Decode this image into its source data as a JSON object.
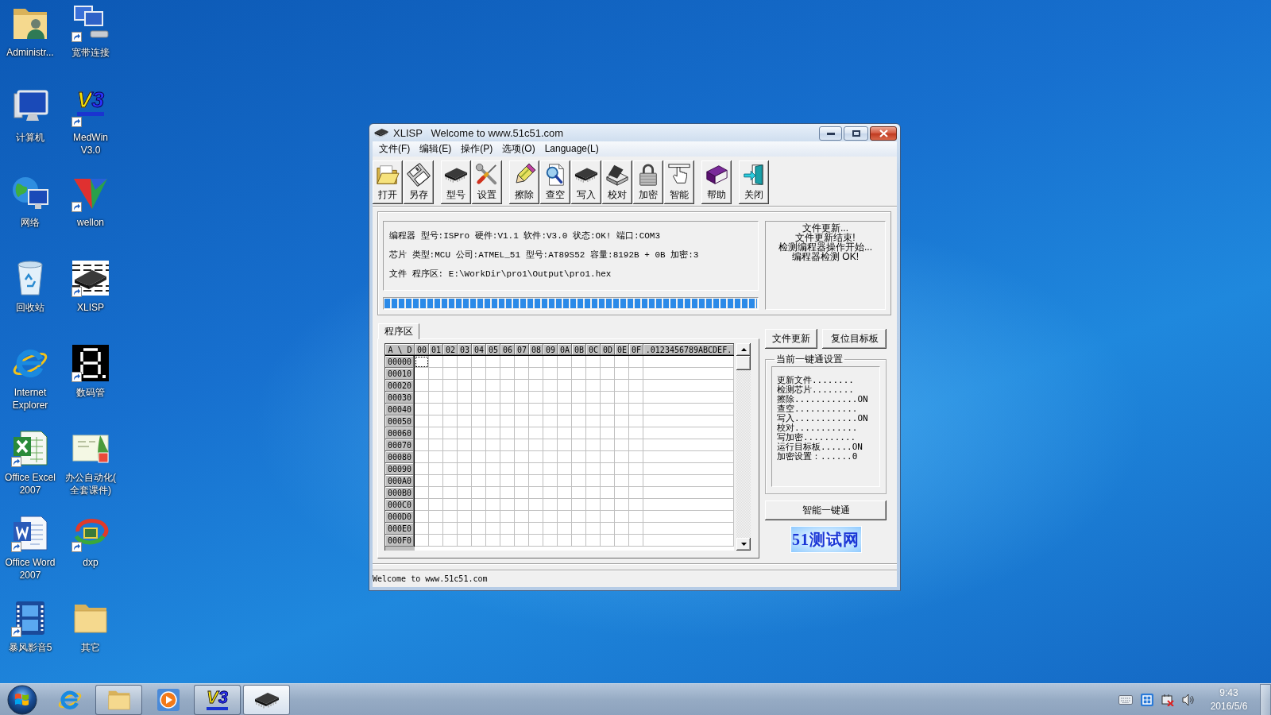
{
  "desktop": {
    "icons": [
      {
        "kind": "user-folder",
        "label": "Administr...",
        "shortcut": false
      },
      {
        "kind": "computer",
        "label": "计算机",
        "shortcut": false
      },
      {
        "kind": "network",
        "label": "网络",
        "shortcut": false
      },
      {
        "kind": "recycle-bin",
        "label": "回收站",
        "shortcut": false
      },
      {
        "kind": "ie",
        "label": "Internet\nExplorer",
        "shortcut": false
      },
      {
        "kind": "excel",
        "label": "Office Excel\n2007",
        "shortcut": true
      },
      {
        "kind": "word",
        "label": "Office Word\n2007",
        "shortcut": true
      },
      {
        "kind": "film",
        "label": "暴风影音5",
        "shortcut": true
      },
      {
        "kind": "network-connection",
        "label": "宽带连接",
        "shortcut": true
      },
      {
        "kind": "logo",
        "logo": "V3",
        "label": "MedWin\nV3.0",
        "shortcut": true
      },
      {
        "kind": "wellon",
        "label": "wellon",
        "shortcut": true
      },
      {
        "kind": "chip",
        "label": "XLISP",
        "shortcut": true
      },
      {
        "kind": "seven-segment",
        "label": "数码管",
        "shortcut": true
      },
      {
        "kind": "thumbnail",
        "label": "办公自动化(\n全套课件)",
        "shortcut": false
      },
      {
        "kind": "dxp",
        "label": "dxp",
        "shortcut": true
      },
      {
        "kind": "folder",
        "label": "其它",
        "shortcut": false
      }
    ]
  },
  "window": {
    "title": "XLISP   Welcome to www.51c51.com",
    "menu": [
      "文件(F)",
      "编辑(E)",
      "操作(P)",
      "选项(O)",
      "Language(L)"
    ],
    "toolbar": [
      {
        "buttons": [
          {
            "kind": "open",
            "label": "打开"
          },
          {
            "kind": "save",
            "label": "另存"
          }
        ]
      },
      {
        "buttons": [
          {
            "kind": "chip",
            "label": "型号"
          },
          {
            "kind": "tools",
            "label": "设置"
          }
        ]
      },
      {
        "buttons": [
          {
            "kind": "eraser",
            "label": "擦除"
          },
          {
            "kind": "search",
            "label": "查空"
          },
          {
            "kind": "chip",
            "label": "写入"
          },
          {
            "kind": "scanner",
            "label": "校对"
          },
          {
            "kind": "lock",
            "label": "加密"
          },
          {
            "kind": "hand",
            "label": "智能"
          }
        ]
      },
      {
        "buttons": [
          {
            "kind": "book",
            "label": "帮助"
          }
        ]
      },
      {
        "buttons": [
          {
            "kind": "exit",
            "label": "关闭"
          }
        ]
      }
    ],
    "info_lines": [
      "编程器 型号:ISPro 硬件:V1.1 软件:V3.0 状态:OK! 端口:COM3",
      "芯片 类型:MCU 公司:ATMEL_51 型号:AT89S52 容量:8192B + 0B 加密:3",
      "文件 程序区: E:\\WorkDir\\pro1\\Output\\pro1.hex"
    ],
    "progress": {
      "level": 1
    },
    "log": [
      "文件更新...",
      "文件更新结束!",
      "检测编程器操作开始...",
      "编程器检测 OK!"
    ],
    "tabs": [
      {
        "label": "程序区",
        "selected": true
      }
    ],
    "hex_grid": {
      "columns": [
        "A \\ D",
        "00",
        "01",
        "02",
        "03",
        "04",
        "05",
        "06",
        "07",
        "08",
        "09",
        "0A",
        "0B",
        "0C",
        "0D",
        "0E",
        "0F",
        ".0123456789ABCDEF."
      ],
      "rows": [
        {
          "address": "00000",
          "focused": true
        },
        {
          "address": "00010",
          "focused": false
        },
        {
          "address": "00020",
          "focused": false
        },
        {
          "address": "00030",
          "focused": false
        },
        {
          "address": "00040",
          "focused": false
        },
        {
          "address": "00050",
          "focused": false
        },
        {
          "address": "00060",
          "focused": false
        },
        {
          "address": "00070",
          "focused": false
        },
        {
          "address": "00080",
          "focused": false
        },
        {
          "address": "00090",
          "focused": false
        },
        {
          "address": "000A0",
          "focused": false
        },
        {
          "address": "000B0",
          "focused": false
        },
        {
          "address": "000C0",
          "focused": false
        },
        {
          "address": "000D0",
          "focused": false
        },
        {
          "address": "000E0",
          "focused": false
        },
        {
          "address": "000F0",
          "focused": false
        }
      ]
    },
    "side_buttons": [
      "文件更新",
      "复位目标板"
    ],
    "one_key_settings": {
      "title": "当前一键通设置",
      "lines": [
        "更新文件........",
        "检测芯片........",
        "擦除............ON",
        "查空............",
        "写入............ON",
        "校对............",
        "写加密..........",
        "运行目标板......ON",
        "加密设置：......0"
      ]
    },
    "one_key_button": "智能一键通",
    "logo": "51测试网",
    "status_bar": "Welcome to www.51c51.com"
  },
  "taskbar": {
    "items": [
      {
        "kind": "ie",
        "running": false,
        "selected": false
      },
      {
        "kind": "explorer",
        "running": true,
        "selected": false
      },
      {
        "kind": "media",
        "running": false,
        "selected": false
      },
      {
        "kind": "logo",
        "logo": "V3",
        "running": true,
        "selected": false
      },
      {
        "kind": "chip",
        "running": true,
        "selected": true
      }
    ],
    "tray": [
      {
        "kind": "keyboard"
      },
      {
        "kind": "ime"
      },
      {
        "kind": "network-error"
      },
      {
        "kind": "volume"
      }
    ],
    "clock": {
      "time": "9:43",
      "date": "2016/5/6"
    }
  }
}
